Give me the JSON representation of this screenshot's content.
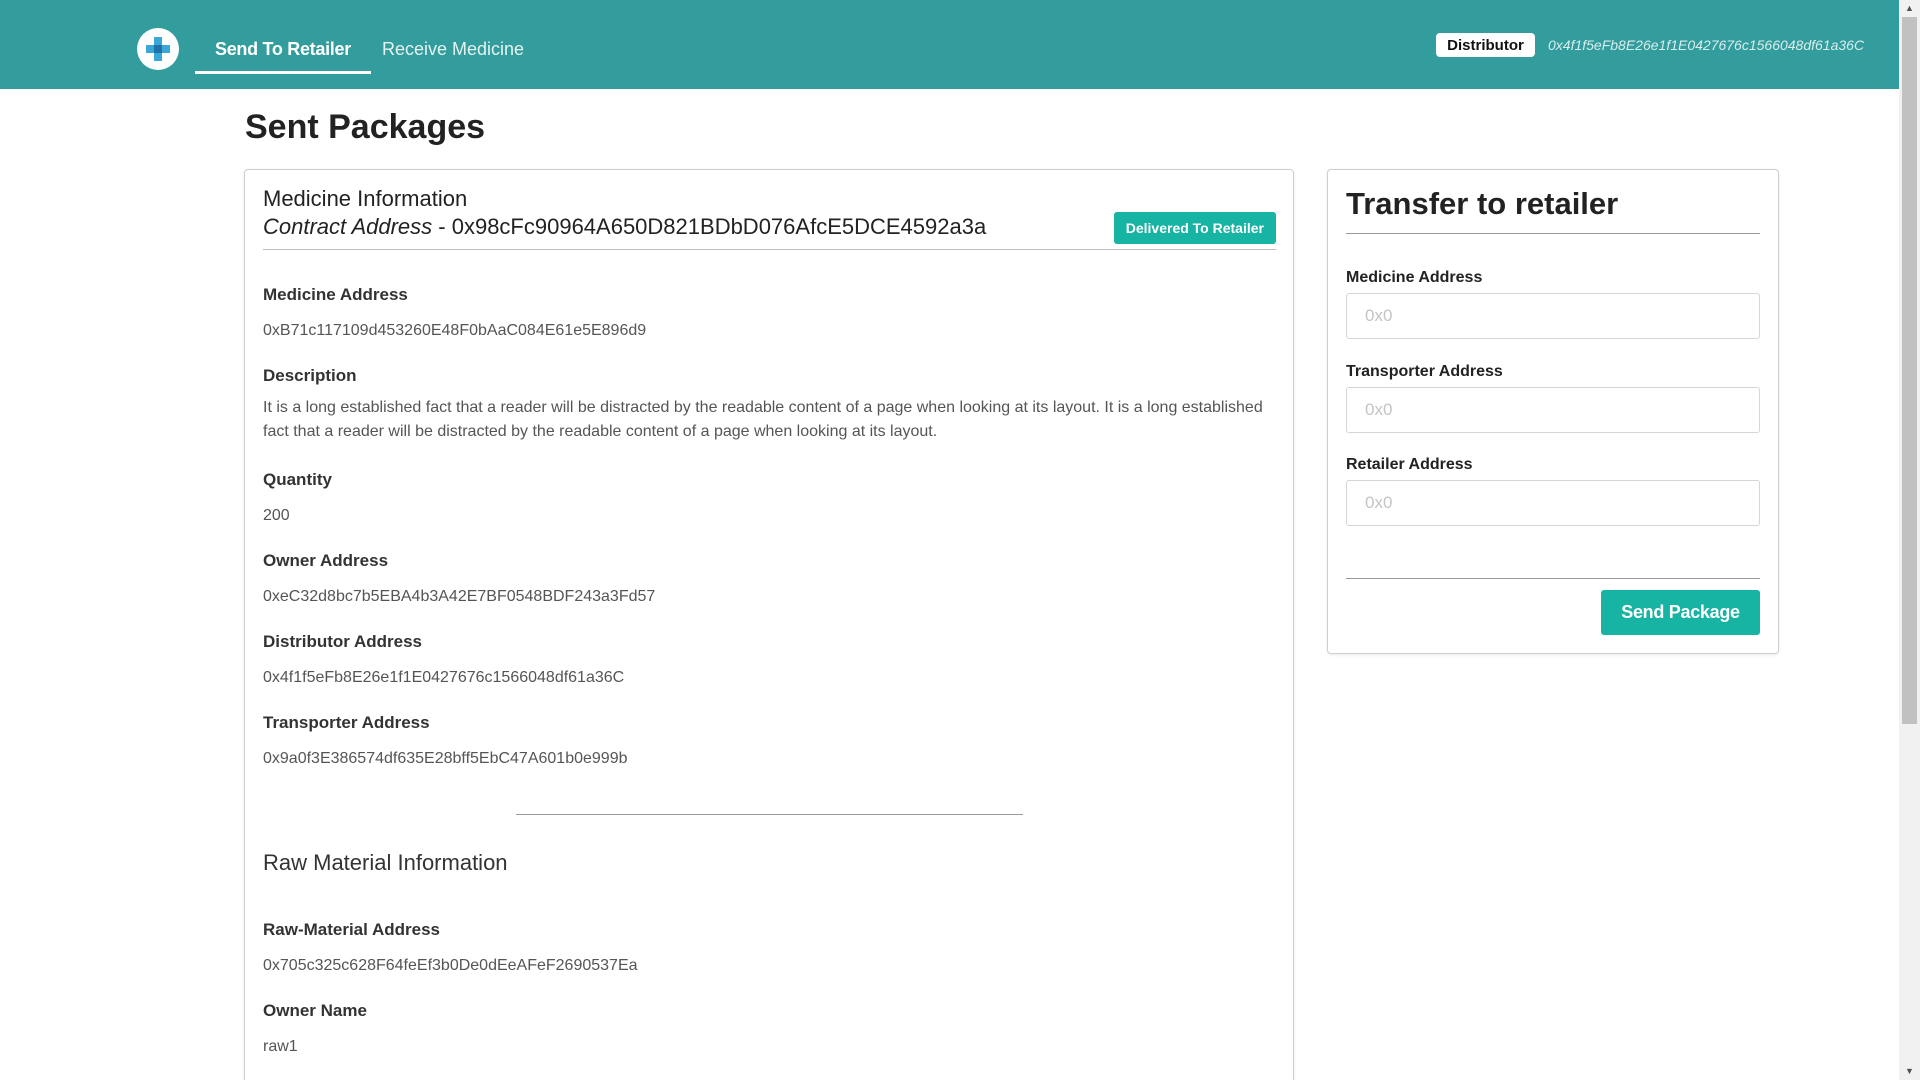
{
  "navbar": {
    "tabs": [
      {
        "label": "Send To Retailer",
        "active": true
      },
      {
        "label": "Receive Medicine",
        "active": false
      }
    ],
    "role": "Distributor",
    "account": "0x4f1f5eFb8E26e1f1E0427676c1566048df61a36C"
  },
  "page": {
    "title": "Sent Packages"
  },
  "package": {
    "header_title": "Medicine Information",
    "contract_label": "Contract Address",
    "contract_sep": " - ",
    "contract_address": "0x98cFc90964A650D821BDbD076AfcE5DCE4592a3a",
    "status": "Delivered To Retailer",
    "fields": [
      {
        "label": "Medicine Address",
        "value": "0xB71c117109d453260E48F0bAaC084E61e5E896d9"
      },
      {
        "label": "Description",
        "value": "It is a long established fact that a reader will be distracted by the readable content of a page when looking at its layout. It is a long established fact that a reader will be distracted by the readable content of a page when looking at its layout."
      },
      {
        "label": "Quantity",
        "value": "200"
      },
      {
        "label": "Owner Address",
        "value": "0xeC32d8bc7b5EBA4b3A42E7BF0548BDF243a3Fd57"
      },
      {
        "label": "Distributor Address",
        "value": "0x4f1f5eFb8E26e1f1E0427676c1566048df61a36C"
      },
      {
        "label": "Transporter Address",
        "value": "0x9a0f3E386574df635E28bff5EbC47A601b0e999b"
      }
    ],
    "raw_section_title": "Raw Material Information",
    "raw_fields": [
      {
        "label": "Raw-Material Address",
        "value": "0x705c325c628F64feEf3b0De0dEeAFeF2690537Ea"
      },
      {
        "label": "Owner Name",
        "value": "raw1"
      }
    ]
  },
  "transfer": {
    "title": "Transfer to retailer",
    "fields": [
      {
        "label": "Medicine Address",
        "placeholder": "0x0"
      },
      {
        "label": "Transporter Address",
        "placeholder": "0x0"
      },
      {
        "label": "Retailer Address",
        "placeholder": "0x0"
      }
    ],
    "submit_label": "Send Package"
  },
  "colors": {
    "navbar": "#339c9c",
    "accent": "#17b3a3"
  }
}
